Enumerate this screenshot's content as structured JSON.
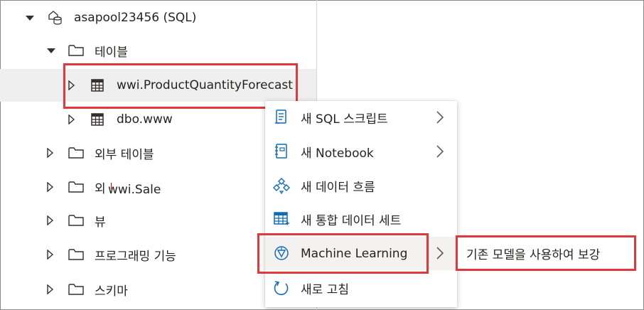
{
  "tree": {
    "pool_label": "asapool23456 (SQL)",
    "tables_folder": "테이블",
    "table_1": "wwi.ProductQuantityForecast",
    "table_2": "dbo.www",
    "external_tables": "외부 테이블",
    "external_resources_partial": "외",
    "views": "뷰",
    "programmability": "프로그래밍 기능",
    "schemas": "스키마"
  },
  "tooltip": {
    "text": "wwi.Sale"
  },
  "context_menu": {
    "items": [
      {
        "label": "새 SQL 스크립트",
        "icon": "sql-script-icon",
        "has_submenu": true
      },
      {
        "label": "새 Notebook",
        "icon": "notebook-icon",
        "has_submenu": true
      },
      {
        "label": "새 데이터 흐름",
        "icon": "dataflow-icon",
        "has_submenu": false
      },
      {
        "label": "새 통합 데이터 세트",
        "icon": "dataset-icon",
        "has_submenu": false
      },
      {
        "label": "Machine Learning",
        "icon": "machine-learning-icon",
        "has_submenu": true
      },
      {
        "label": "새로 고침",
        "icon": "refresh-icon",
        "has_submenu": false
      }
    ]
  },
  "submenu": {
    "label": "기존 모델을 사용하여 보강"
  },
  "colors": {
    "highlight_border": "#e0383d",
    "icon_blue": "#0f6cbd",
    "selected_row": "#efefef"
  }
}
